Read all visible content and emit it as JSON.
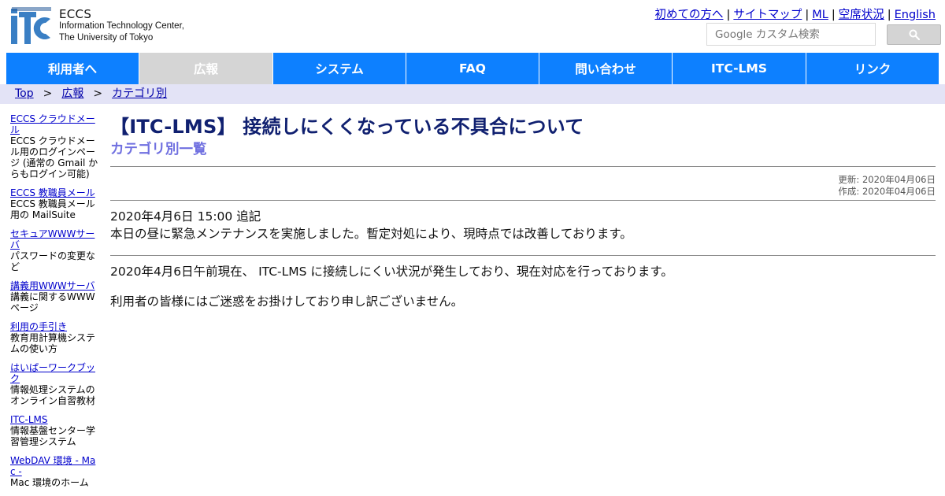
{
  "logo": {
    "name": "ECCS",
    "line2": "Information Technology Center,",
    "line3": "The University of Tokyo"
  },
  "top_links": [
    "初めての方へ",
    "サイトマップ",
    "ML",
    "空席状況",
    "English"
  ],
  "top_links_separator": "|",
  "search": {
    "placeholder": "Google カスタム検索",
    "button_icon": "search-icon"
  },
  "nav": {
    "items": [
      "利用者へ",
      "広報",
      "システム",
      "FAQ",
      "問い合わせ",
      "ITC-LMS",
      "リンク"
    ],
    "active_index": 1
  },
  "breadcrumb": {
    "items": [
      "Top",
      "広報",
      "カテゴリ別"
    ],
    "separator": ">"
  },
  "sidebar": [
    {
      "link": "ECCS クラウドメール",
      "desc": "ECCS クラウドメール用のログインページ (通常の Gmail からもログイン可能)"
    },
    {
      "link": "ECCS 教職員メール",
      "desc": "ECCS 教職員メール用の MailSuite"
    },
    {
      "link": "セキュアWWWサーバ",
      "desc": "パスワードの変更など"
    },
    {
      "link": "講義用WWWサーバ",
      "desc": "講義に関するWWWページ"
    },
    {
      "link": "利用の手引き",
      "desc": "教育用計算機システムの使い方"
    },
    {
      "link": "はいぱーワークブック",
      "desc": "情報処理システムのオンライン自習教材"
    },
    {
      "link": "ITC-LMS",
      "desc": "情報基盤センター学習管理システム"
    },
    {
      "link": "WebDAV 環境 - Mac -",
      "desc": "Mac 環境のホーム"
    }
  ],
  "main": {
    "title": "【ITC-LMS】 接続しにくくなっている不具合について",
    "category": "カテゴリ別一覧",
    "updated": "更新: 2020年04月06日",
    "created": "作成: 2020年04月06日",
    "note_heading": "2020年4月6日 15:00 追記",
    "note_body": "本日の昼に緊急メンテナンスを実施しました。暫定対処により、現時点では改善しております。",
    "status": "2020年4月6日午前現在、 ITC-LMS に接続しにくい状況が発生しており、現在対応を行っております。",
    "apology": "利用者の皆様にはご迷惑をお掛けしており申し訳ございません。"
  },
  "colors": {
    "nav_blue": "#0d80ff",
    "nav_active": "#d5d5d5",
    "breadcrumb_bg": "#e3e3f6",
    "title": "#102070",
    "category": "#7070e0",
    "link": "#0000cc"
  }
}
